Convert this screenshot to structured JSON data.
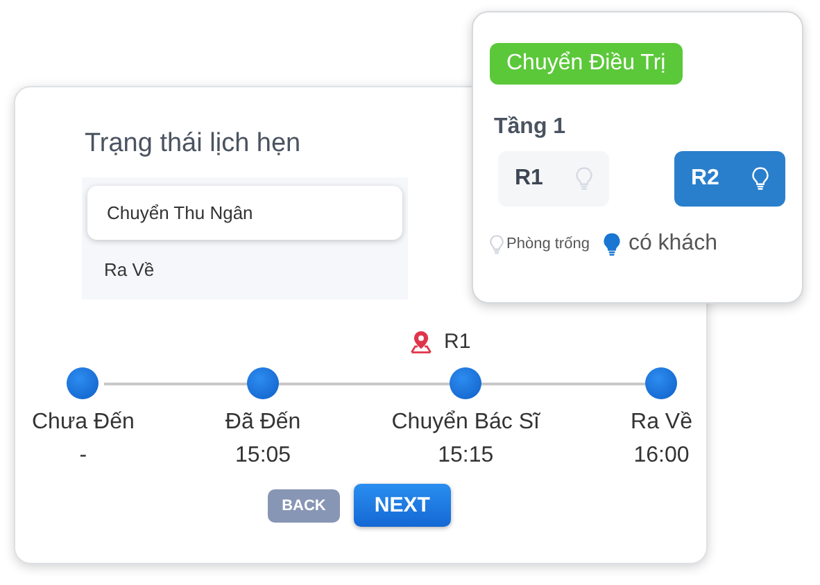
{
  "appointment_card": {
    "title": "Trạng thái lịch hẹn",
    "status_options": [
      {
        "label": "Chuyển Thu Ngân",
        "selected": true
      },
      {
        "label": "Ra Về",
        "selected": false
      }
    ],
    "location": "R1",
    "steps": [
      {
        "label": "Chưa Đến",
        "time": "-"
      },
      {
        "label": "Đã Đến",
        "time": "15:05"
      },
      {
        "label": "Chuyển Bác Sĩ",
        "time": "15:15"
      },
      {
        "label": "Ra Về",
        "time": "16:00"
      }
    ],
    "buttons": [
      {
        "label": "BACK",
        "kind": "secondary"
      },
      {
        "label": "NEXT",
        "kind": "primary"
      }
    ]
  },
  "room_popup": {
    "tag": "Chuyển Điều Trị",
    "floor": "Tầng 1",
    "rooms": [
      {
        "name": "R1",
        "occupied": false
      },
      {
        "name": "R2",
        "occupied": true
      }
    ],
    "legend": [
      {
        "label": "Phòng trống",
        "occupied": false
      },
      {
        "label": "có khách",
        "occupied": true
      }
    ]
  }
}
